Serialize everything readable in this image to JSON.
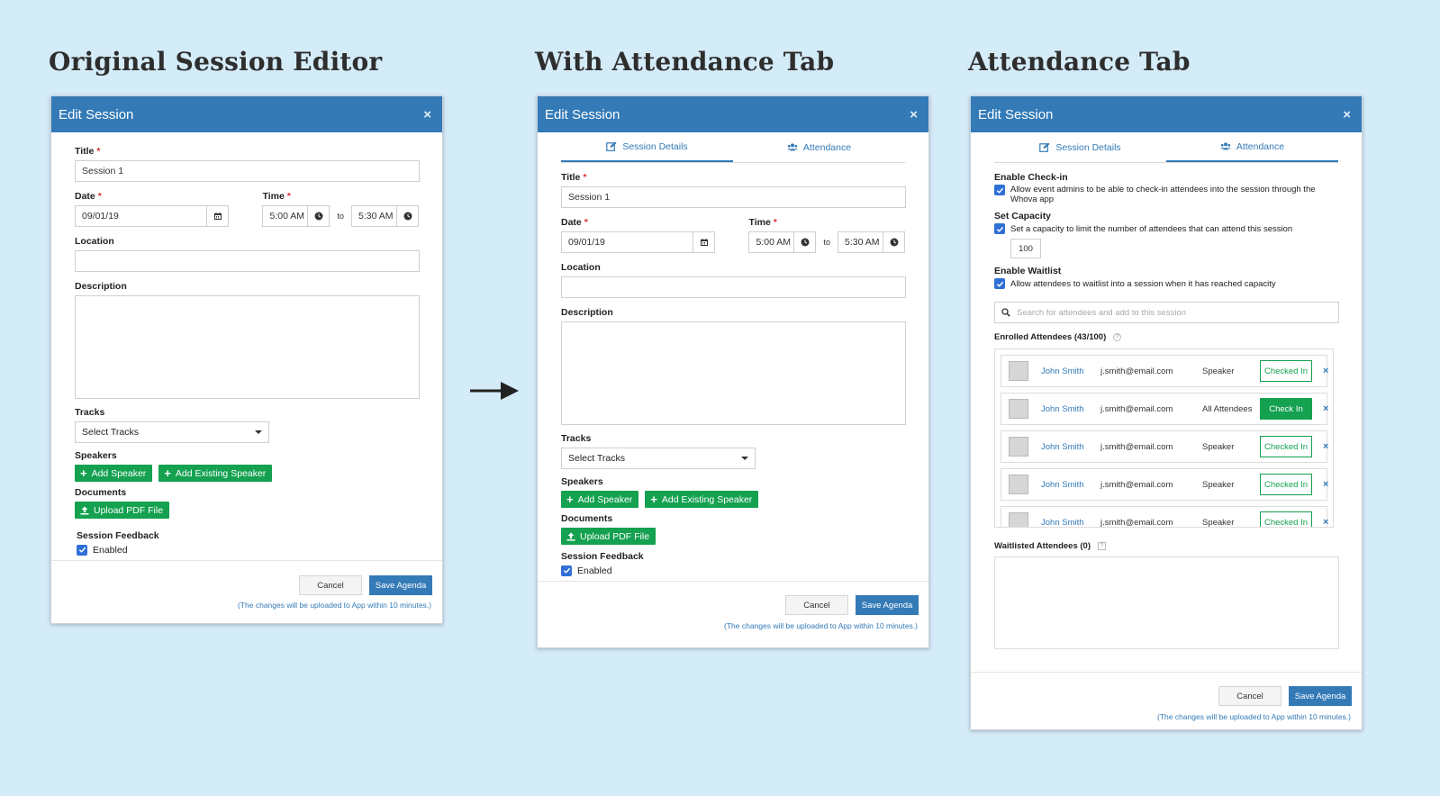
{
  "headings": {
    "original": "Original Session Editor",
    "with_tab": "With Attendance Tab",
    "attendance": "Attendance Tab"
  },
  "modal": {
    "title": "Edit Session",
    "close": "×"
  },
  "form": {
    "title_label": "Title",
    "required_mark": "*",
    "title_value": "Session 1",
    "date_label": "Date",
    "date_value": "09/01/19",
    "time_label": "Time",
    "time_start": "5:00 AM",
    "time_to": "to",
    "time_end": "5:30 AM",
    "location_label": "Location",
    "description_label": "Description",
    "tracks_label": "Tracks",
    "tracks_placeholder": "Select Tracks",
    "speakers_label": "Speakers",
    "add_speaker": "Add Speaker",
    "add_existing_speaker": "Add Existing Speaker",
    "documents_label": "Documents",
    "upload_pdf": "Upload PDF File",
    "feedback_label": "Session Feedback",
    "feedback_enabled": "Enabled"
  },
  "footer": {
    "cancel": "Cancel",
    "save": "Save Agenda",
    "note": "(The changes will be uploaded to App within 10 minutes.)"
  },
  "tabs": {
    "details": "Session Details",
    "attendance": "Attendance"
  },
  "attendance": {
    "enable_checkin_label": "Enable Check-in",
    "enable_checkin_text": "Allow event admins to be able to check-in attendees into the session through the Whova app",
    "capacity_label": "Set Capacity",
    "capacity_text": "Set a capacity to limit the number of attendees that can attend this session",
    "capacity_value": "100",
    "waitlist_label": "Enable Waitlist",
    "waitlist_text": "Allow attendees to waitlist into a session when it has reached capacity",
    "search_placeholder": "Search for attendees and add to this session",
    "enrolled_label": "Enrolled Attendees (43/100)",
    "waitlisted_label": "Waitlisted Attendees (0)",
    "rows": [
      {
        "name": "John Smith",
        "email": "j.smith@email.com",
        "type": "Speaker",
        "status": "Checked In"
      },
      {
        "name": "John Smith",
        "email": "j.smith@email.com",
        "type": "All Attendees",
        "status": "Check In"
      },
      {
        "name": "John Smith",
        "email": "j.smith@email.com",
        "type": "Speaker",
        "status": "Checked In"
      },
      {
        "name": "John Smith",
        "email": "j.smith@email.com",
        "type": "Speaker",
        "status": "Checked In"
      },
      {
        "name": "John Smith",
        "email": "j.smith@email.com",
        "type": "Speaker",
        "status": "Checked In"
      }
    ]
  },
  "colors": {
    "header": "#337ab7",
    "green": "#14a150",
    "background": "#d4ebf8"
  }
}
